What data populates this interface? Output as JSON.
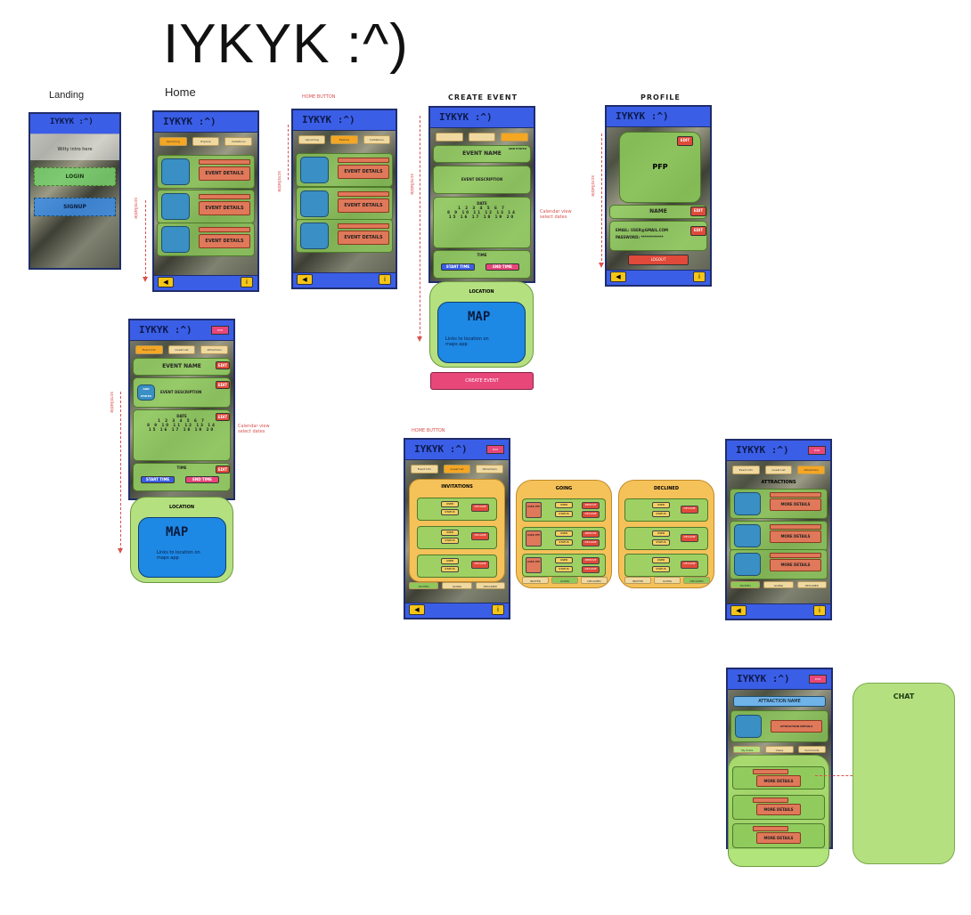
{
  "page": {
    "title": "IYKYK :^)"
  },
  "screens": {
    "landing": {
      "caption": "Landing",
      "header": "IYKYK :^)",
      "subtext": "Witty intro here",
      "login": "LOGIN",
      "signup": "SIGNUP"
    },
    "home": {
      "caption": "Home",
      "header": "IYKYK :^)",
      "tabs": [
        "Upcoming",
        "Explore",
        "Invitations"
      ],
      "event_button": "EVENT DETAILS",
      "scroll_note": "scrollable",
      "footer_info": "i"
    },
    "home_button": {
      "note": "HOME BUTTON",
      "header": "IYKYK :^)",
      "tabs": [
        "Upcoming",
        "Explore",
        "Invitations"
      ],
      "event_button": "EVENT DETAILS",
      "scroll_note": "scrollable"
    },
    "create_event": {
      "caption": "CREATE EVENT",
      "header": "IYKYK :^)",
      "event_name": "EVENT NAME",
      "add_photo": "ADD PHOTO",
      "description": "EVENT DESCRIPTION",
      "date_label": "DATE",
      "calendar_note_1": "Calendar view",
      "calendar_note_2": "select dates",
      "time_label": "TIME",
      "start_time": "START TIME",
      "end_time": "END TIME",
      "location_label": "LOCATION",
      "map": "MAP",
      "map_note": "Links to location on maps app",
      "submit": "CREATE EVENT",
      "scroll_note": "scrollable"
    },
    "profile": {
      "caption": "PROFILE",
      "header": "IYKYK :^)",
      "pfp": "PFP",
      "name": "NAME",
      "edit": "EDIT",
      "email": "EMAIL: USER@GMAIL.COM",
      "password": "PASSWORD: ************",
      "logout": "LOGOUT",
      "scroll_note": "scrollable"
    },
    "event_details": {
      "header": "IYKYK :^)",
      "header_btn": "Edit",
      "tabs": [
        "Event Info",
        "Guest List",
        "Attractions"
      ],
      "event_name": "EVENT NAME",
      "add_photo": "ADD PHOTO",
      "description": "EVENT DESCRIPTION",
      "date_label": "DATE",
      "time_label": "TIME",
      "start_time": "START TIME",
      "end_time": "END TIME",
      "location_label": "LOCATION",
      "map": "MAP",
      "map_note": "Links to location on maps app",
      "edit": "EDIT",
      "calendar_note_1": "Calendar view",
      "calendar_note_2": "select dates",
      "scroll_note": "scrollable"
    },
    "invitations": {
      "note": "HOME BUTTON",
      "header": "IYKYK :^)",
      "header_btn": "Edit",
      "tabs": [
        "Event Info",
        "Guest List",
        "Attractions"
      ],
      "panel_title": "INVITATIONS",
      "going_title": "GOING",
      "declined_title": "DECLINED",
      "person": "USER",
      "status": "STATUS",
      "decline": "DECLINE",
      "pfp": "USER PFP",
      "remove": "REMOVE",
      "bottom_tabs": [
        "INVITED",
        "GOING",
        "DECLINED"
      ]
    },
    "attractions": {
      "header": "IYKYK :^)",
      "header_btn": "Edit",
      "tabs": [
        "Event Info",
        "Guest List",
        "Attractions"
      ],
      "title": "ATTRACTIONS",
      "row_button": "MORE DETAILS",
      "bottom_tabs": [
        "INVITED",
        "GOING",
        "DECLINED"
      ]
    },
    "attraction_detail": {
      "header": "IYKYK :^)",
      "header_btn": "Edit",
      "name": "ATTRACTION NAME",
      "info_button": "ATTRACTION DETAILS",
      "tabs": [
        "My Posts",
        "Views",
        "Comments"
      ],
      "row_button": "MORE DETAILS"
    },
    "chat": {
      "title": "CHAT"
    }
  },
  "colors": {
    "header_blue": "#3b5ee6",
    "green": "#8cc85a",
    "orange": "#f5c25a",
    "pink": "#e8477a",
    "red_annot": "#d9534f"
  }
}
